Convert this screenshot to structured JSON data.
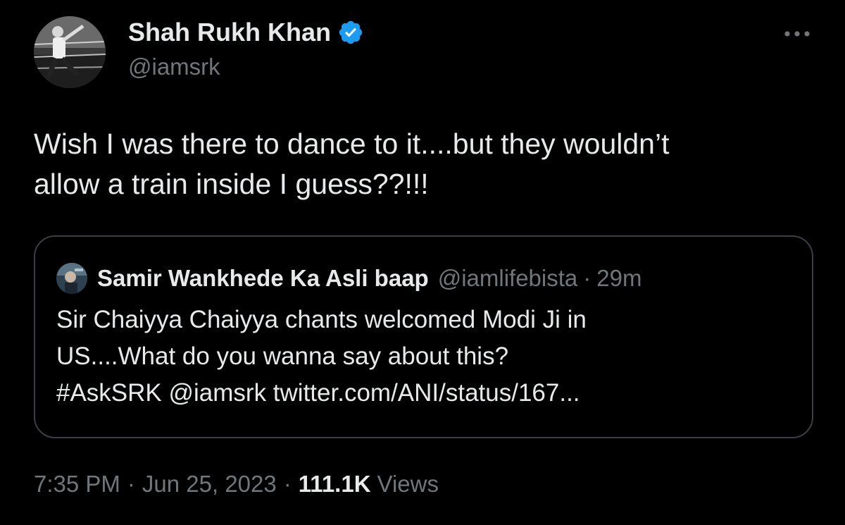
{
  "author": {
    "display_name": "Shah Rukh Khan",
    "handle": "@iamsrk",
    "verified": true
  },
  "menu": {
    "icon": "more-horizontal-icon"
  },
  "tweet": {
    "text_lines": [
      "Wish I was there to dance to it....but they wouldn’t",
      "allow a train inside I guess??!!!"
    ]
  },
  "quoted_tweet": {
    "display_name": "Samir Wankhede Ka Asli baap",
    "handle": "@iamlifebista",
    "separator": "·",
    "time": "29m",
    "text_lines": [
      "Sir Chaiyya  Chaiyya chants welcomed Modi Ji in",
      "US....What do you wanna say about this?",
      "#AskSRK @iamsrk twitter.com/ANI/status/167..."
    ]
  },
  "meta": {
    "time": "7:35 PM",
    "separator": "·",
    "date": "Jun 25, 2023",
    "views_count": "111.1K",
    "views_label": "Views"
  },
  "colors": {
    "background": "#000000",
    "primary_text": "#e7e9ea",
    "secondary_text": "#71767b",
    "verified_badge": "#1d9bf0",
    "quote_border": "#3b3f43"
  }
}
